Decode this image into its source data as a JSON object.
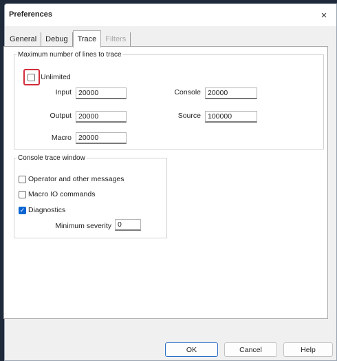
{
  "dialog": {
    "title": "Preferences",
    "close_glyph": "×"
  },
  "tabs": [
    {
      "label": "General",
      "active": false,
      "disabled": false
    },
    {
      "label": "Debug",
      "active": false,
      "disabled": false
    },
    {
      "label": "Trace",
      "active": true,
      "disabled": false
    },
    {
      "label": "Filters",
      "active": false,
      "disabled": true
    }
  ],
  "trace_lines": {
    "legend": "Maximum number of lines to trace",
    "unlimited_label": "Unlimited",
    "unlimited_checked": false,
    "input_label": "Input",
    "input_value": "20000",
    "output_label": "Output",
    "output_value": "20000",
    "macro_label": "Macro",
    "macro_value": "20000",
    "console_label": "Console",
    "console_value": "20000",
    "source_label": "Source",
    "source_value": "100000"
  },
  "console_window": {
    "legend": "Console trace window",
    "operator_label": "Operator and other messages",
    "operator_checked": false,
    "macro_io_label": "Macro IO commands",
    "macro_io_checked": false,
    "diagnostics_label": "Diagnostics",
    "diagnostics_checked": true,
    "severity_label": "Minimum severity",
    "severity_value": "0"
  },
  "buttons": {
    "ok": "OK",
    "cancel": "Cancel",
    "help": "Help"
  },
  "colors": {
    "highlight": "#d32c3a",
    "checked": "#0a64d2"
  },
  "check_glyph": "✓"
}
